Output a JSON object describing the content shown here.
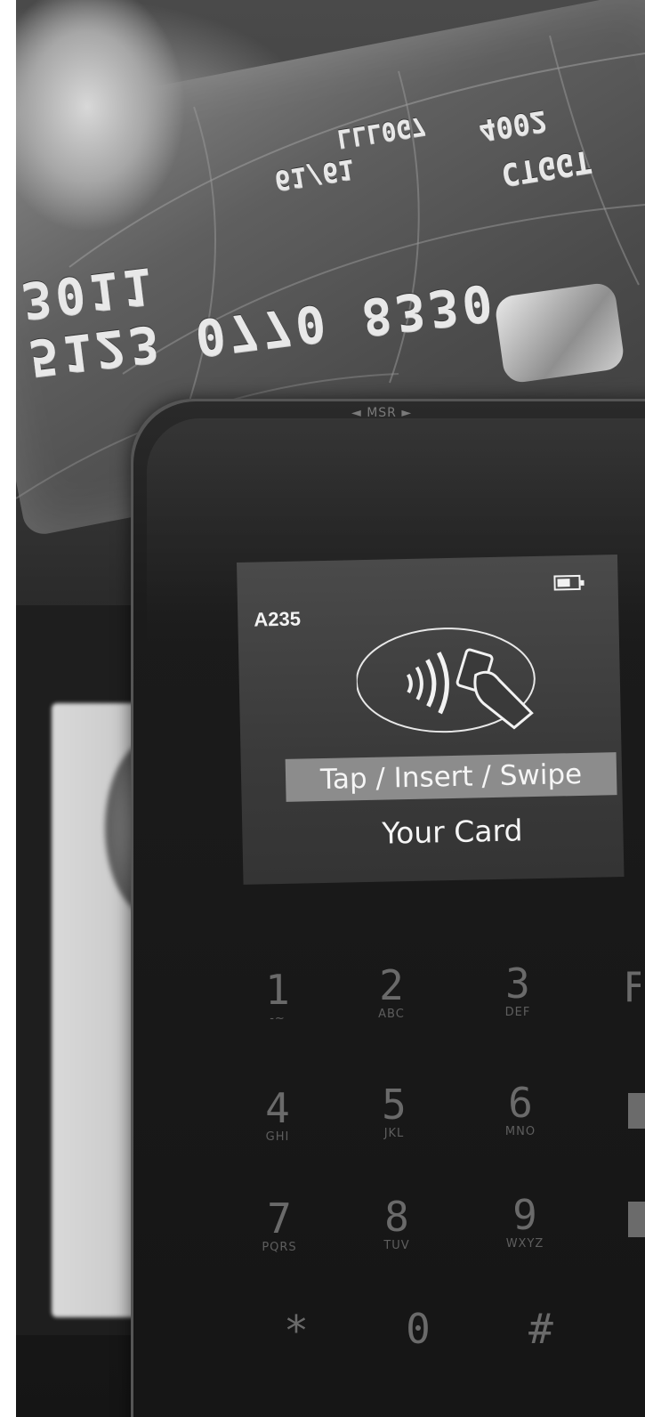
{
  "terminal": {
    "msr_label": "◄ MSR ►",
    "screen": {
      "terminal_code": "A235",
      "instruction_line1": "Tap / Insert / Swipe",
      "instruction_line2": "Your Card",
      "icons": [
        "battery-icon",
        "contactless-payment-icon"
      ]
    },
    "keypad": {
      "keys": [
        {
          "digit": "1",
          "letters": "-~"
        },
        {
          "digit": "2",
          "letters": "ABC"
        },
        {
          "digit": "3",
          "letters": "DEF"
        },
        {
          "digit": "4",
          "letters": "GHI"
        },
        {
          "digit": "5",
          "letters": "JKL"
        },
        {
          "digit": "6",
          "letters": "MNO"
        },
        {
          "digit": "7",
          "letters": "PQRS"
        },
        {
          "digit": "8",
          "letters": "TUV"
        },
        {
          "digit": "9",
          "letters": "WXYZ"
        },
        {
          "digit": "*",
          "letters": ""
        },
        {
          "digit": "0",
          "letters": ""
        },
        {
          "digit": "#",
          "letters": ""
        }
      ],
      "edge_key_char": "F"
    }
  },
  "credit_card": {
    "number_mirrored": "5123 0770 8330 3011",
    "meta_a": "61/61",
    "meta_b": "LLL0G7",
    "meta_c": "4002",
    "meta_d": "CTGGT"
  },
  "colors": {
    "screen_background": "#3a3a3a",
    "screen_text": "#f5f5f5",
    "highlight_band": "#8c8c8c",
    "terminal_body": "#1b1b1b"
  }
}
